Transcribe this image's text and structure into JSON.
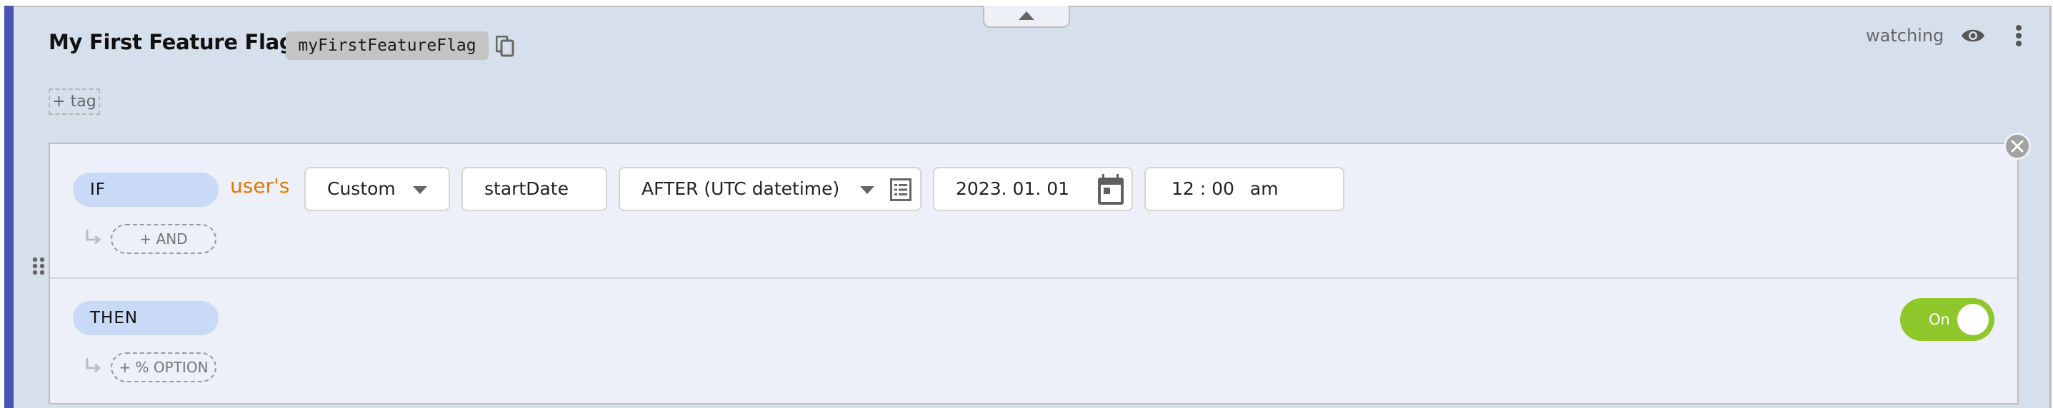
{
  "flag": {
    "title": "My First Feature Flag",
    "key": "myFirstFeatureFlag",
    "add_tag_label": "+ tag",
    "watching_label": "watching"
  },
  "colors": {
    "accent": "#4a54b4",
    "panel_bg": "#d6e0ec",
    "rule_bg": "#edf0f8",
    "pill_bg": "#c8daf5",
    "users_text": "#e07b00",
    "toggle_on": "#8ec72a"
  },
  "icons": {
    "copy": "copy-icon",
    "collapse": "caret-up-icon",
    "watch": "eye-icon",
    "menu": "kebab-icon",
    "close": "close-icon",
    "drag": "drag-handle-icon",
    "list": "list-icon",
    "calendar": "calendar-icon",
    "sub_arrow": "subdirectory-arrow-icon"
  },
  "rule": {
    "if_label": "IF",
    "subject_label": "user's",
    "attribute_type": "Custom",
    "attribute_name": "startDate",
    "operator": "AFTER (UTC datetime)",
    "date_value": "2023. 01. 01",
    "time_hour": "12",
    "time_sep": ":",
    "time_minute": "00",
    "time_ampm": "am",
    "add_and_label": "+ AND",
    "then_label": "THEN",
    "add_option_label": "+ % OPTION",
    "serve_toggle": {
      "label": "On",
      "state": true
    }
  }
}
